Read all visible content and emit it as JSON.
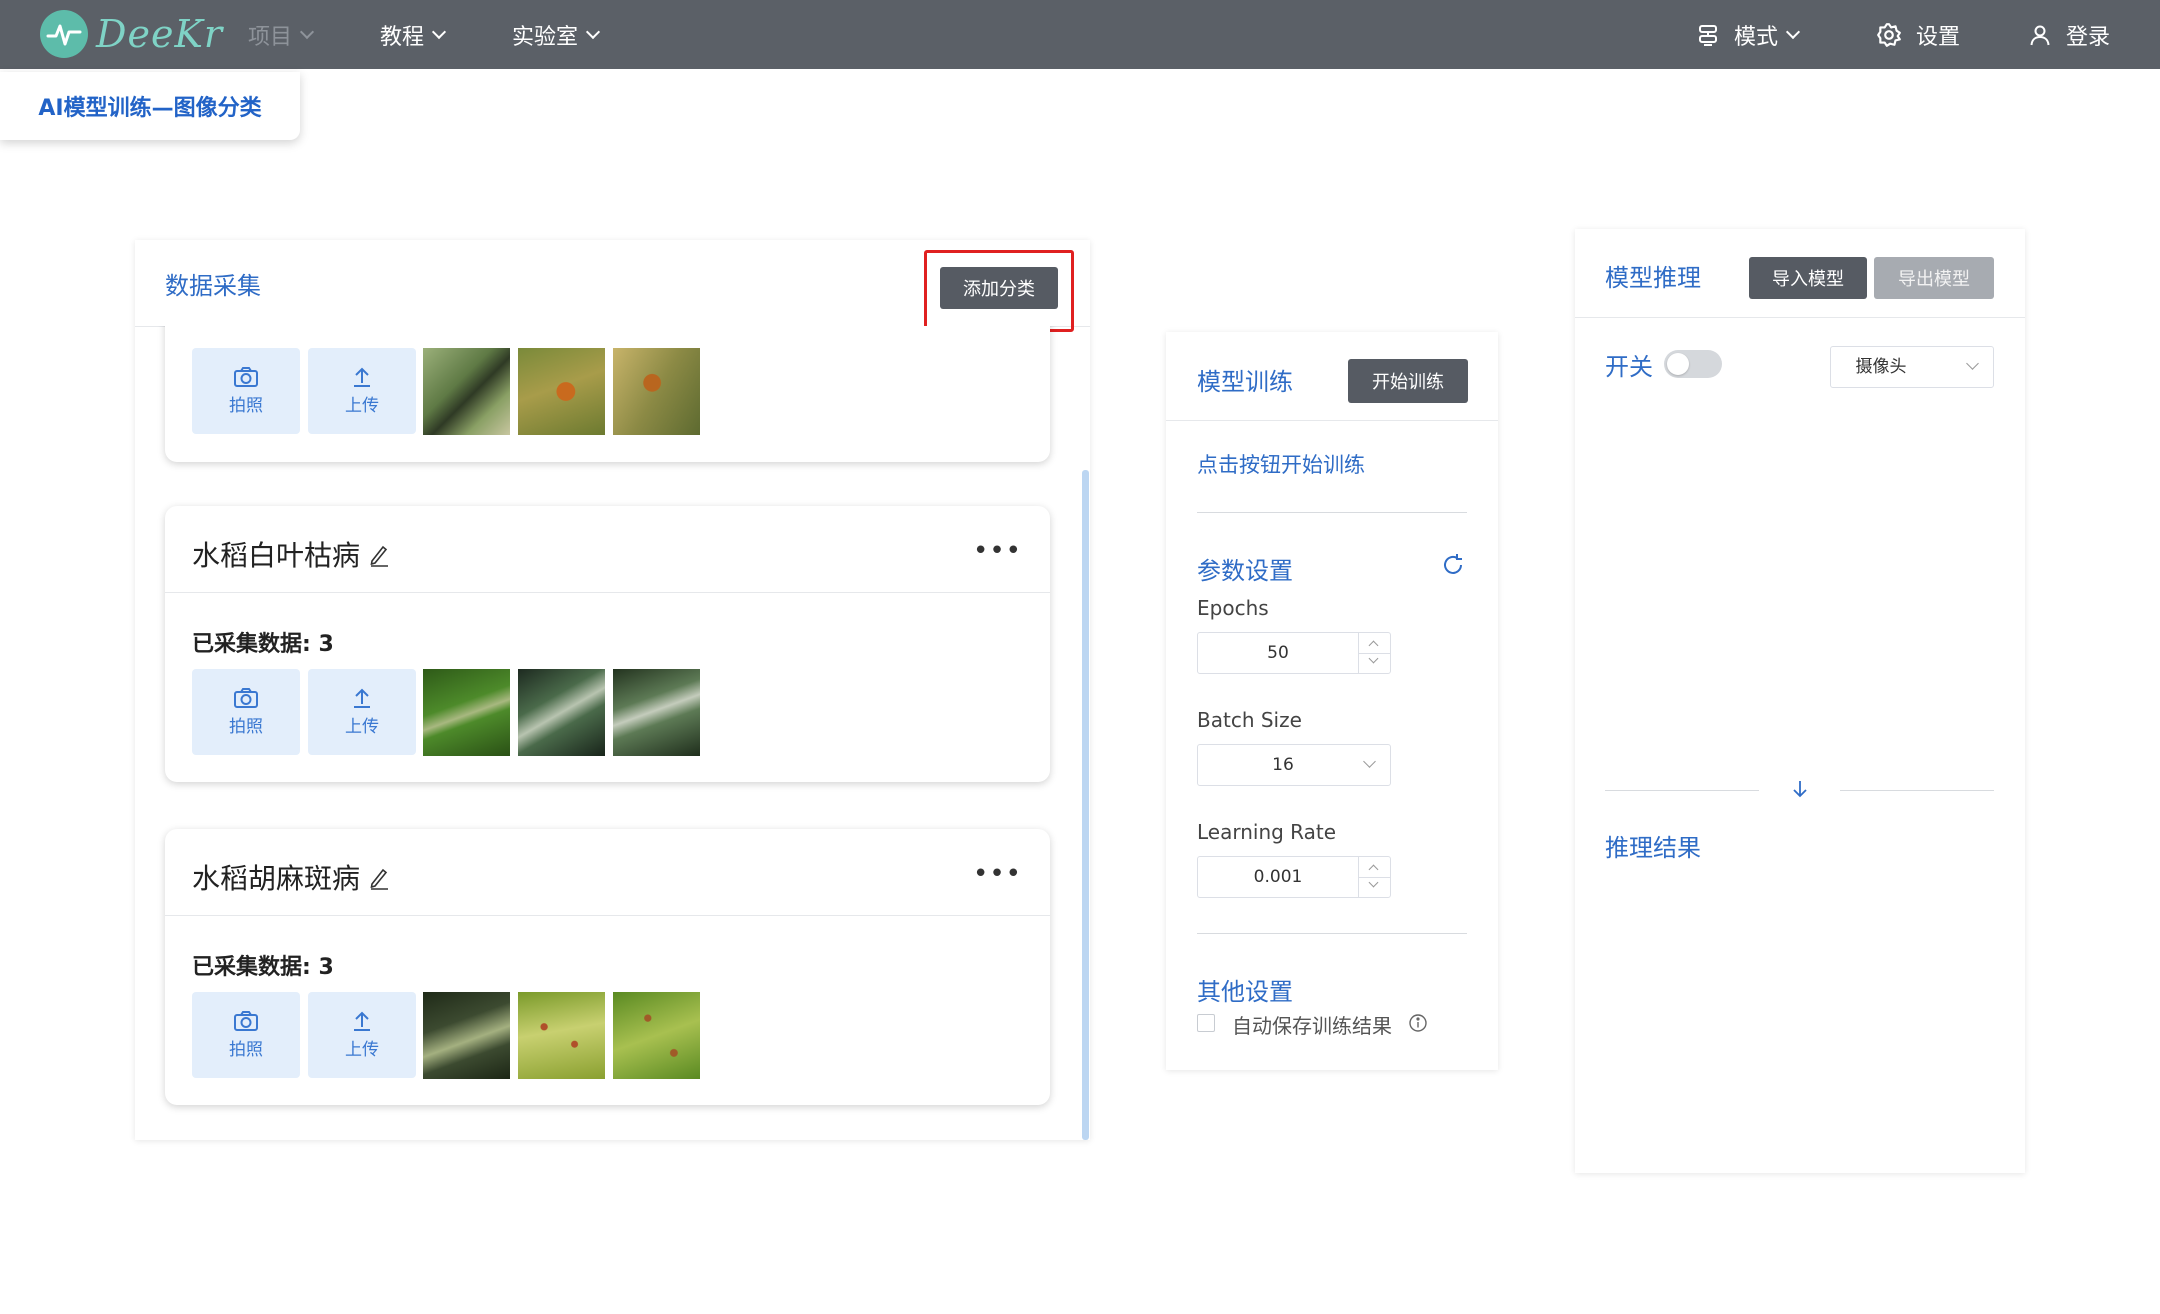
{
  "topbar": {
    "brand": "DeeKr",
    "nav": {
      "projects": "项目",
      "tutorial": "教程",
      "lab": "实验室",
      "mode": "模式",
      "settings": "设置",
      "login": "登录"
    }
  },
  "page_title": "AI模型训练—图像分类",
  "data_collection": {
    "title": "数据采集",
    "add_category_label": "添加分类",
    "categories": [
      {
        "name": "",
        "count_label": "",
        "photo_label": "拍照",
        "upload_label": "上传",
        "thumbnail_colors": [
          "#6f8a55",
          "#8c8a3f",
          "#9a8a48"
        ]
      },
      {
        "name": "水稻白叶枯病",
        "count_label": "已采集数据: 3",
        "photo_label": "拍照",
        "upload_label": "上传",
        "thumbnail_colors": [
          "#3f7a25",
          "#2f4a3a",
          "#3c5a3a"
        ]
      },
      {
        "name": "水稻胡麻斑病",
        "count_label": "已采集数据: 3",
        "photo_label": "拍照",
        "upload_label": "上传",
        "thumbnail_colors": [
          "#3a4a30",
          "#8aa040",
          "#7aa83a"
        ]
      }
    ]
  },
  "training": {
    "title": "模型训练",
    "start_label": "开始训练",
    "hint": "点击按钮开始训练",
    "params_title": "参数设置",
    "epochs_label": "Epochs",
    "epochs_value": "50",
    "batch_size_label": "Batch Size",
    "batch_size_value": "16",
    "learning_rate_label": "Learning Rate",
    "learning_rate_value": "0.001",
    "other_title": "其他设置",
    "autosave_label": "自动保存训练结果"
  },
  "inference": {
    "title": "模型推理",
    "import_label": "导入模型",
    "export_label": "导出模型",
    "switch_label": "开关",
    "camera_value": "摄像头",
    "result_title": "推理结果"
  },
  "colors": {
    "topbar": "#5b6067",
    "accent_blue": "#2f6cc6",
    "dark_button": "#565b63",
    "highlight_red": "#e02020"
  }
}
